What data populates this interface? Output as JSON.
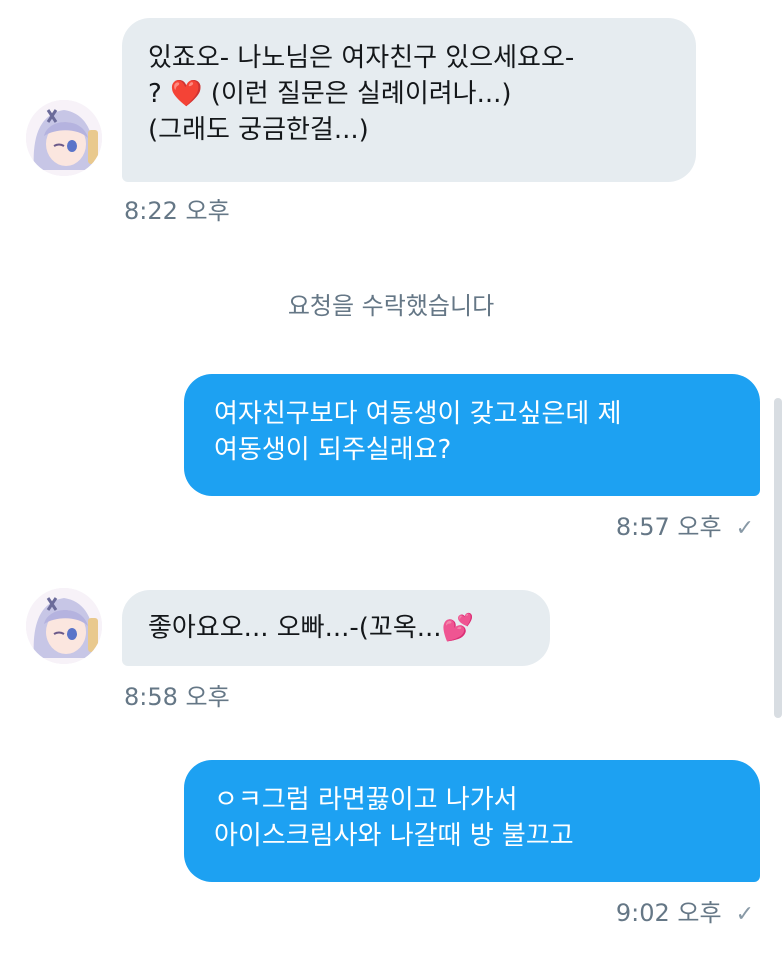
{
  "messages": [
    {
      "side": "incoming",
      "text": "있죠오- 나노님은 여자친구 있으세요오-\n? ❤️ (이런 질문은 실례이려나...)\n(그래도 궁금한걸...)",
      "time": "8:22 오후"
    },
    {
      "side": "system",
      "text": "요청을 수락했습니다"
    },
    {
      "side": "outgoing",
      "text": "여자친구보다 여동생이 갖고싶은데 제\n여동생이 되주실래요?",
      "time": "8:57 오후"
    },
    {
      "side": "incoming",
      "text": "좋아요오... 오빠...-(꼬옥...💕",
      "time": "8:58 오후"
    },
    {
      "side": "outgoing",
      "text": "ㅇㅋ그럼 라면끓이고 나가서\n아이스크림사와 나갈때 방 불끄고",
      "time": "9:02 오후"
    }
  ],
  "icons": {
    "read_receipt": "checkmark-icon",
    "avatar": "anime-girl-avatar"
  },
  "colors": {
    "outgoing_bubble": "#1da1f2",
    "incoming_bubble": "#e6ecf0",
    "timestamp": "#657786"
  }
}
